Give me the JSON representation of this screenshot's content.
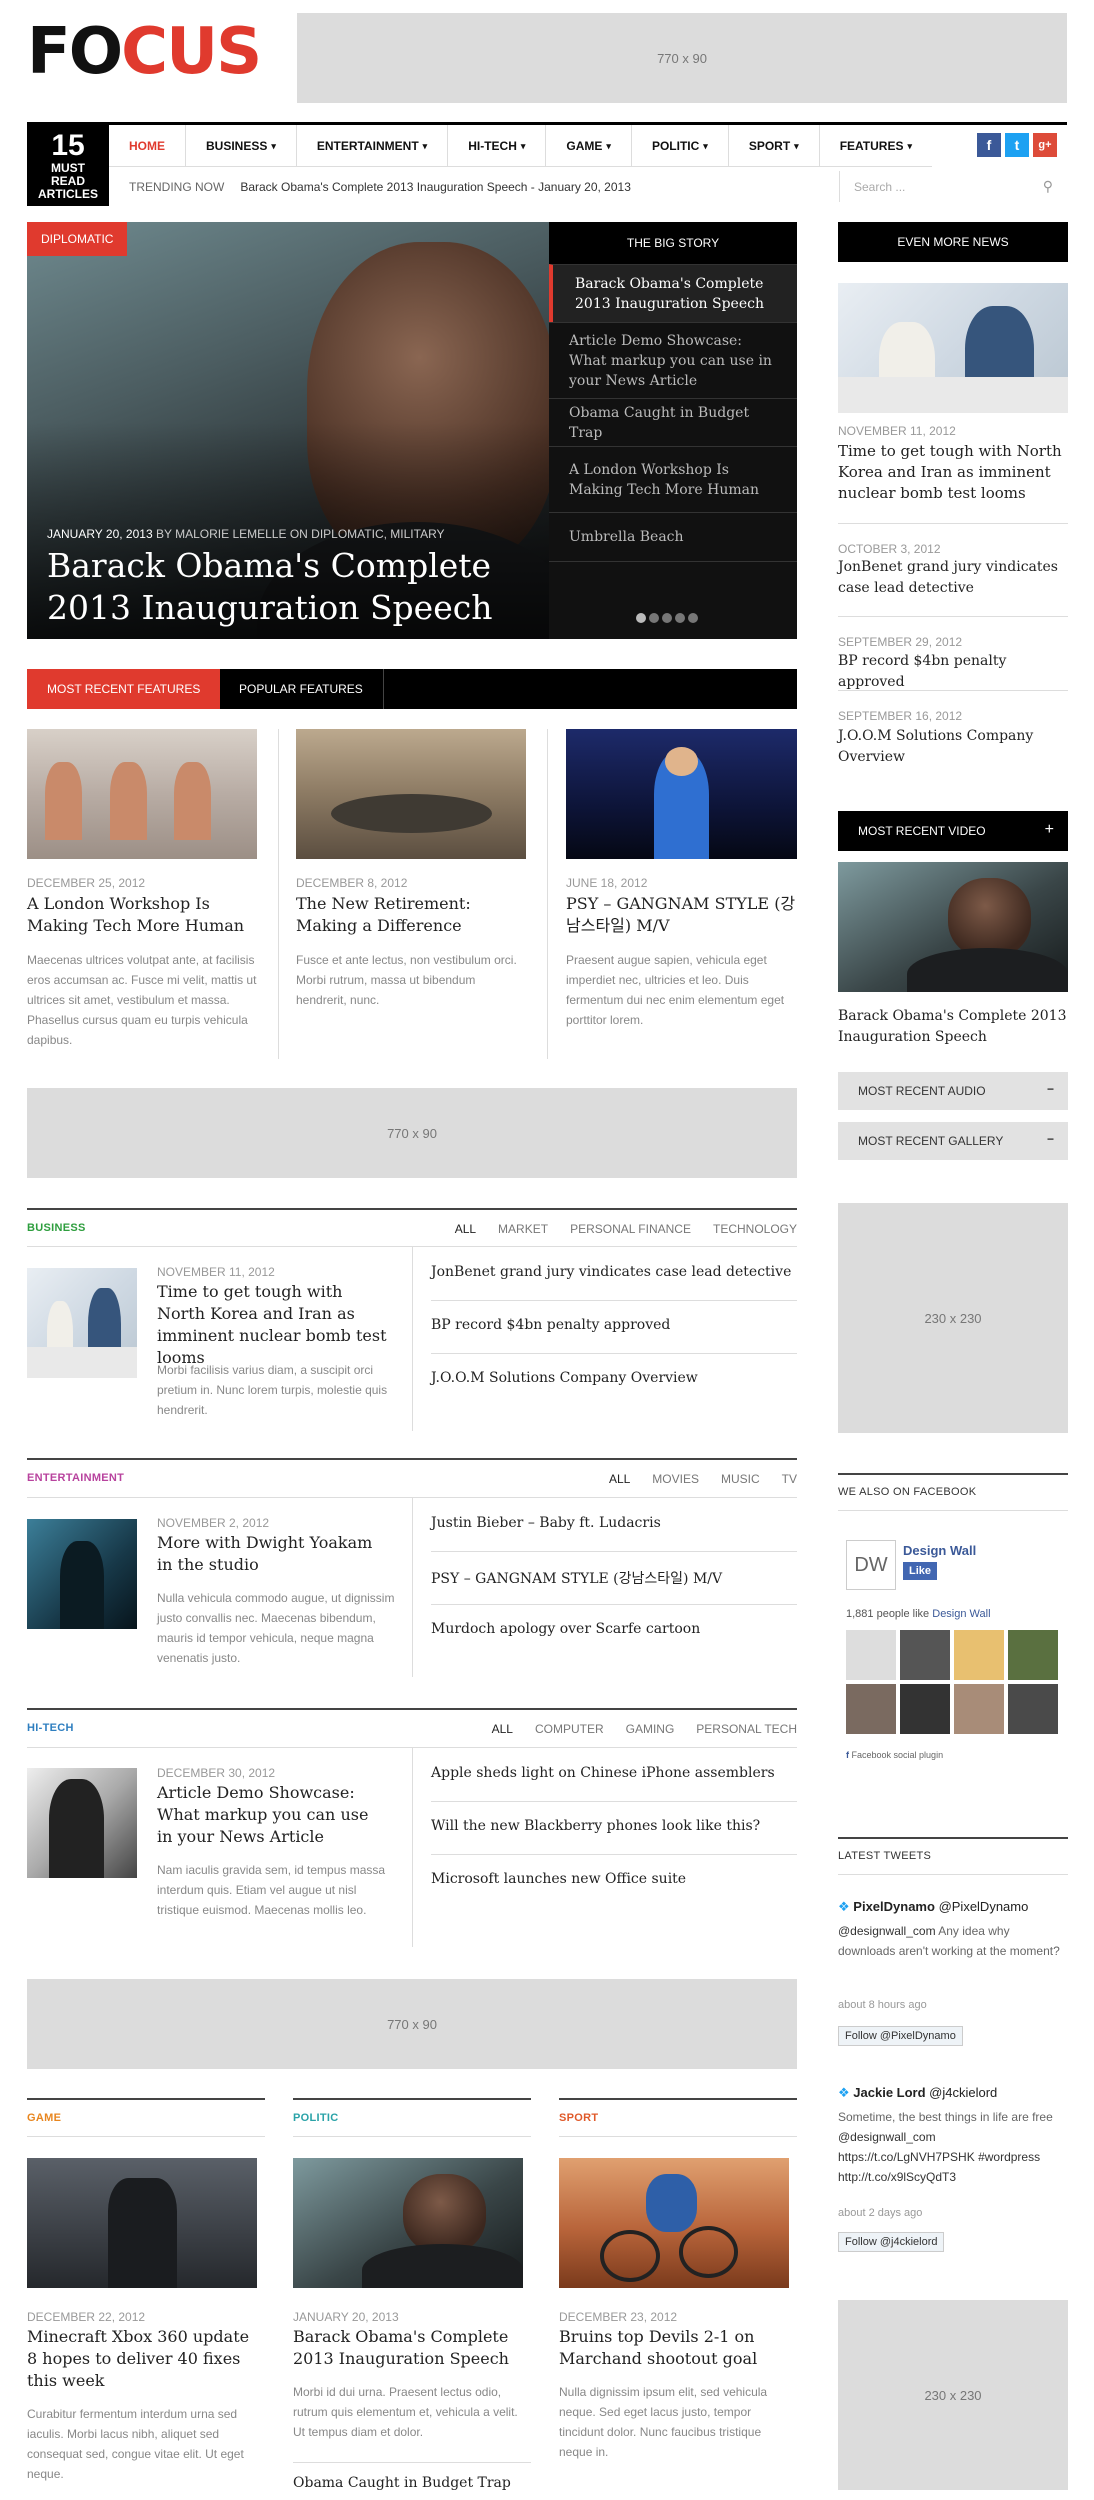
{
  "site": {
    "logo_dark": "FO",
    "logo_red": "CUS"
  },
  "ads": {
    "header": "770 x 90",
    "mid1": "770 x 90",
    "mid2": "770 x 90",
    "side1": "230 x 230",
    "side2": "230 x 230"
  },
  "date_box": {
    "day": "15",
    "line1": "MUST",
    "line2": "READ",
    "line3": "ARTICLES"
  },
  "menu": [
    {
      "label": "HOME",
      "caret": ""
    },
    {
      "label": "BUSINESS",
      "caret": "▾"
    },
    {
      "label": "ENTERTAINMENT",
      "caret": "▾"
    },
    {
      "label": "HI-TECH",
      "caret": "▾"
    },
    {
      "label": "GAME",
      "caret": "▾"
    },
    {
      "label": "POLITIC",
      "caret": "▾"
    },
    {
      "label": "SPORT",
      "caret": "▾"
    },
    {
      "label": "FEATURES",
      "caret": "▾"
    }
  ],
  "social": {
    "facebook": "f",
    "twitter": "t",
    "google": "g+"
  },
  "trending": {
    "label": "TRENDING NOW",
    "text": "Barack Obama's Complete 2013 Inauguration Speech - January 20, 2013"
  },
  "search": {
    "placeholder": "Search ..."
  },
  "hero": {
    "tag": "DIPLOMATIC",
    "date": "JANUARY 20, 2013",
    "by": "BY",
    "author": "MALORIE LEMELLE",
    "on": "ON",
    "cats": "DIPLOMATIC, MILITARY",
    "title": "Barack Obama's Complete 2013 Inauguration Speech"
  },
  "big_story": {
    "heading": "THE BIG STORY",
    "items": [
      "Barack Obama's Complete 2013 Inauguration Speech",
      "Article Demo Showcase: What markup you can use in your News Article",
      "Obama Caught in Budget Trap",
      "A London Workshop Is Making Tech More Human",
      "Umbrella Beach"
    ]
  },
  "features_tabs": {
    "recent": "MOST RECENT FEATURES",
    "popular": "POPULAR FEATURES"
  },
  "features": [
    {
      "date": "DECEMBER 25, 2012",
      "title": "A London Workshop Is Making Tech More Human",
      "excerpt": "Maecenas ultrices volutpat ante, at facilisis eros accumsan ac. Fusce mi velit, mattis ut ultrices sit amet, vestibulum et massa. Phasellus cursus quam eu turpis vehicula dapibus."
    },
    {
      "date": "DECEMBER 8, 2012",
      "title": "The New Retirement: Making a Difference",
      "excerpt": "Fusce et ante lectus, non vestibulum orci. Morbi rutrum, massa ut bibendum hendrerit, nunc."
    },
    {
      "date": "JUNE 18, 2012",
      "title": "PSY – GANGNAM STYLE (강남스타일) M/V",
      "excerpt": "Praesent augue sapien, vehicula eget imperdiet nec, ultricies et leo. Duis fermentum dui nec enim elementum eget porttitor lorem."
    }
  ],
  "business": {
    "name": "BUSINESS",
    "color": "#2e9e3e",
    "tabs": [
      "ALL",
      "MARKET",
      "PERSONAL FINANCE",
      "TECHNOLOGY"
    ],
    "date": "NOVEMBER 11, 2012",
    "title": "Time to get tough with North Korea and Iran as imminent nuclear bomb test looms",
    "excerpt": "Morbi facilisis varius diam, a suscipit orci pretium in. Nunc lorem turpis, molestie quis hendrerit.",
    "links": [
      "JonBenet grand jury vindicates case lead detective",
      "BP record $4bn penalty approved",
      "J.O.O.M Solutions Company Overview"
    ]
  },
  "entertainment": {
    "name": "ENTERTAINMENT",
    "color": "#b8439e",
    "tabs": [
      "ALL",
      "MOVIES",
      "MUSIC",
      "TV"
    ],
    "date": "NOVEMBER 2, 2012",
    "title": "More with Dwight Yoakam in the studio",
    "excerpt": "Nulla vehicula commodo augue, ut dignissim justo convallis nec. Maecenas bibendum, mauris id tempor vehicula, neque magna venenatis justo.",
    "links": [
      "Justin Bieber – Baby ft. Ludacris",
      "PSY – GANGNAM STYLE (강남스타일) M/V",
      "Murdoch apology over Scarfe cartoon"
    ]
  },
  "hitech": {
    "name": "HI-TECH",
    "color": "#2f7fc0",
    "tabs": [
      "ALL",
      "COMPUTER",
      "GAMING",
      "PERSONAL TECH"
    ],
    "date": "DECEMBER 30, 2012",
    "title": "Article Demo Showcase: What markup you can use in your News Article",
    "excerpt": "Nam iaculis gravida sem, id tempus massa interdum quis. Etiam vel augue ut nisl tristique euismod. Maecenas mollis leo.",
    "links": [
      "Apple sheds light on Chinese iPhone assemblers",
      "Will the new Blackberry phones look like this?",
      "Microsoft launches new Office suite"
    ]
  },
  "bottom": [
    {
      "name": "GAME",
      "color": "#e8861f",
      "date": "DECEMBER 22, 2012",
      "title": "Minecraft Xbox 360 update 8 hopes to deliver 40 fixes this week",
      "excerpt": "Curabitur fermentum interdum urna sed iaculis. Morbi lacus nibh, aliquet sed consequat sed, congue vitae elit. Ut eget neque."
    },
    {
      "name": "POLITIC",
      "color": "#2aa3a8",
      "date": "JANUARY 20, 2013",
      "title": "Barack Obama's Complete 2013 Inauguration Speech",
      "excerpt": "Morbi id dui urna. Praesent lectus odio, rutrum quis elementum et, vehicula a velit. Ut tempus diam et dolor.",
      "link": "Obama Caught in Budget Trap"
    },
    {
      "name": "SPORT",
      "color": "#e05a2a",
      "date": "DECEMBER 23, 2012",
      "title": "Bruins top Devils 2-1 on Marchand shootout goal",
      "excerpt": "Nulla dignissim ipsum elit, sed vehicula neque. Sed eget lacus justo, tempor tincidunt dolor. Nunc faucibus tristique neque in."
    }
  ],
  "sidebar": {
    "even_more": "EVEN MORE NEWS",
    "news": [
      {
        "date": "NOVEMBER 11, 2012",
        "title": "Time to get tough with North Korea and Iran as imminent nuclear bomb test looms"
      },
      {
        "date": "OCTOBER 3, 2012",
        "title": "JonBenet grand jury vindicates case lead detective"
      },
      {
        "date": "SEPTEMBER 29, 2012",
        "title": "BP record $4bn penalty approved"
      },
      {
        "date": "SEPTEMBER 16, 2012",
        "title": "J.O.O.M Solutions Company Overview"
      }
    ],
    "video_head": "MOST RECENT VIDEO",
    "video_plus": "+",
    "video_title": "Barack Obama's Complete 2013 Inauguration Speech",
    "audio": "MOST RECENT AUDIO",
    "gallery": "MOST RECENT GALLERY",
    "minus": "−",
    "facebook_head": "WE ALSO ON FACEBOOK",
    "fb_page": "Design Wall",
    "fb_logo": "DW",
    "fb_like": "Like",
    "fb_count": "1,881 people like",
    "fb_count_link": "Design Wall",
    "fb_plugin": "Facebook social plugin",
    "tweets_head": "LATEST TWEETS",
    "tweets": [
      {
        "name": "PixelDynamo",
        "handle": "@PixelDynamo",
        "mention": "@designwall_com",
        "text": "Any idea why downloads aren't working at the moment?",
        "time": "about 8 hours ago",
        "follow": "Follow @PixelDynamo"
      },
      {
        "name": "Jackie Lord",
        "handle": "@j4ckielord",
        "text": "Sometime, the best things in life are free",
        "mention": "@designwall_com",
        "link1": "https://t.co/LgNVH7PSHK",
        "tag": "#wordpress",
        "link2": "http://t.co/x9lScyQdT3",
        "time": "about 2 days ago",
        "follow": "Follow @j4ckielord"
      }
    ]
  },
  "colors": {
    "accent": "#e03a2e",
    "dark": "#000000"
  }
}
